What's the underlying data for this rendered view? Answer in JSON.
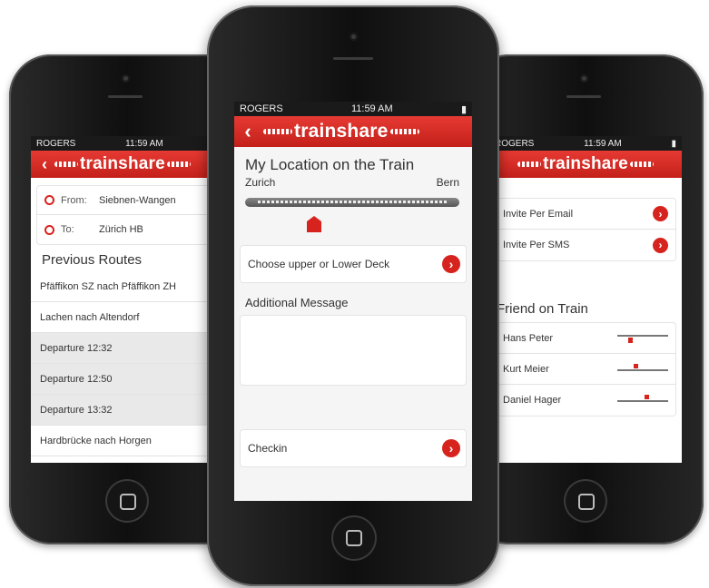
{
  "brand": {
    "logo_text": "trainshare",
    "accent": "#d7231d"
  },
  "left": {
    "status": {
      "carrier": "ROGERS",
      "time": "11:59 AM"
    },
    "from_label": "From:",
    "from_value": "Siebnen-Wangen",
    "to_label": "To:",
    "to_value": "Zürich HB",
    "section_title": "Previous Routes",
    "routes": [
      "Pfäffikon SZ nach Pfäffikon ZH",
      "Lachen nach Altendorf",
      "Departure 12:32",
      "Departure 12:50",
      "Departure 13:32",
      "Hardbrücke nach Horgen"
    ]
  },
  "center": {
    "status": {
      "carrier": "ROGERS",
      "time": "11:59 AM"
    },
    "title": "My Location on the Train",
    "origin": "Zurich",
    "destination": "Bern",
    "deck_label": "Choose upper or Lower Deck",
    "message_label": "Additional Message",
    "message_value": "",
    "checkin_label": "Checkin"
  },
  "right": {
    "status": {
      "carrier": "ROGERS",
      "time": "11:59 AM"
    },
    "invite_email": "Invite Per Email",
    "invite_sms": "Invite Per SMS",
    "friends_title": "Friend on Train",
    "friends": [
      "Hans Peter",
      "Kurt Meier",
      "Daniel Hager"
    ]
  }
}
